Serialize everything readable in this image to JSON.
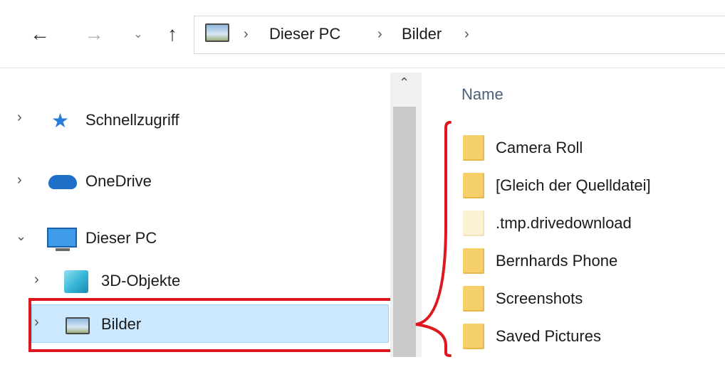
{
  "toolbar": {
    "back_icon": "arrow-left-icon",
    "forward_icon": "arrow-right-icon",
    "recent_icon": "chevron-down-icon",
    "up_icon": "arrow-up-icon",
    "breadcrumb": [
      "Dieser PC",
      "Bilder"
    ]
  },
  "sidebar": {
    "items": [
      {
        "label": "Schnellzugriff",
        "icon": "star-icon"
      },
      {
        "label": "OneDrive",
        "icon": "cloud-icon"
      },
      {
        "label": "Dieser PC",
        "icon": "monitor-icon"
      },
      {
        "label": "3D-Objekte",
        "icon": "cube-icon"
      },
      {
        "label": "Bilder",
        "icon": "pictures-icon"
      }
    ]
  },
  "filelist": {
    "column_header": "Name",
    "items": [
      {
        "name": "Camera Roll"
      },
      {
        "name": "[Gleich der Quelldatei]"
      },
      {
        "name": ".tmp.drivedownload"
      },
      {
        "name": "Bernhards Phone"
      },
      {
        "name": "Screenshots"
      },
      {
        "name": "Saved Pictures"
      }
    ]
  },
  "colors": {
    "selected_bg": "#cce8ff",
    "annotation_red": "#e0161e",
    "folder_yellow": "#f5cf6a"
  }
}
